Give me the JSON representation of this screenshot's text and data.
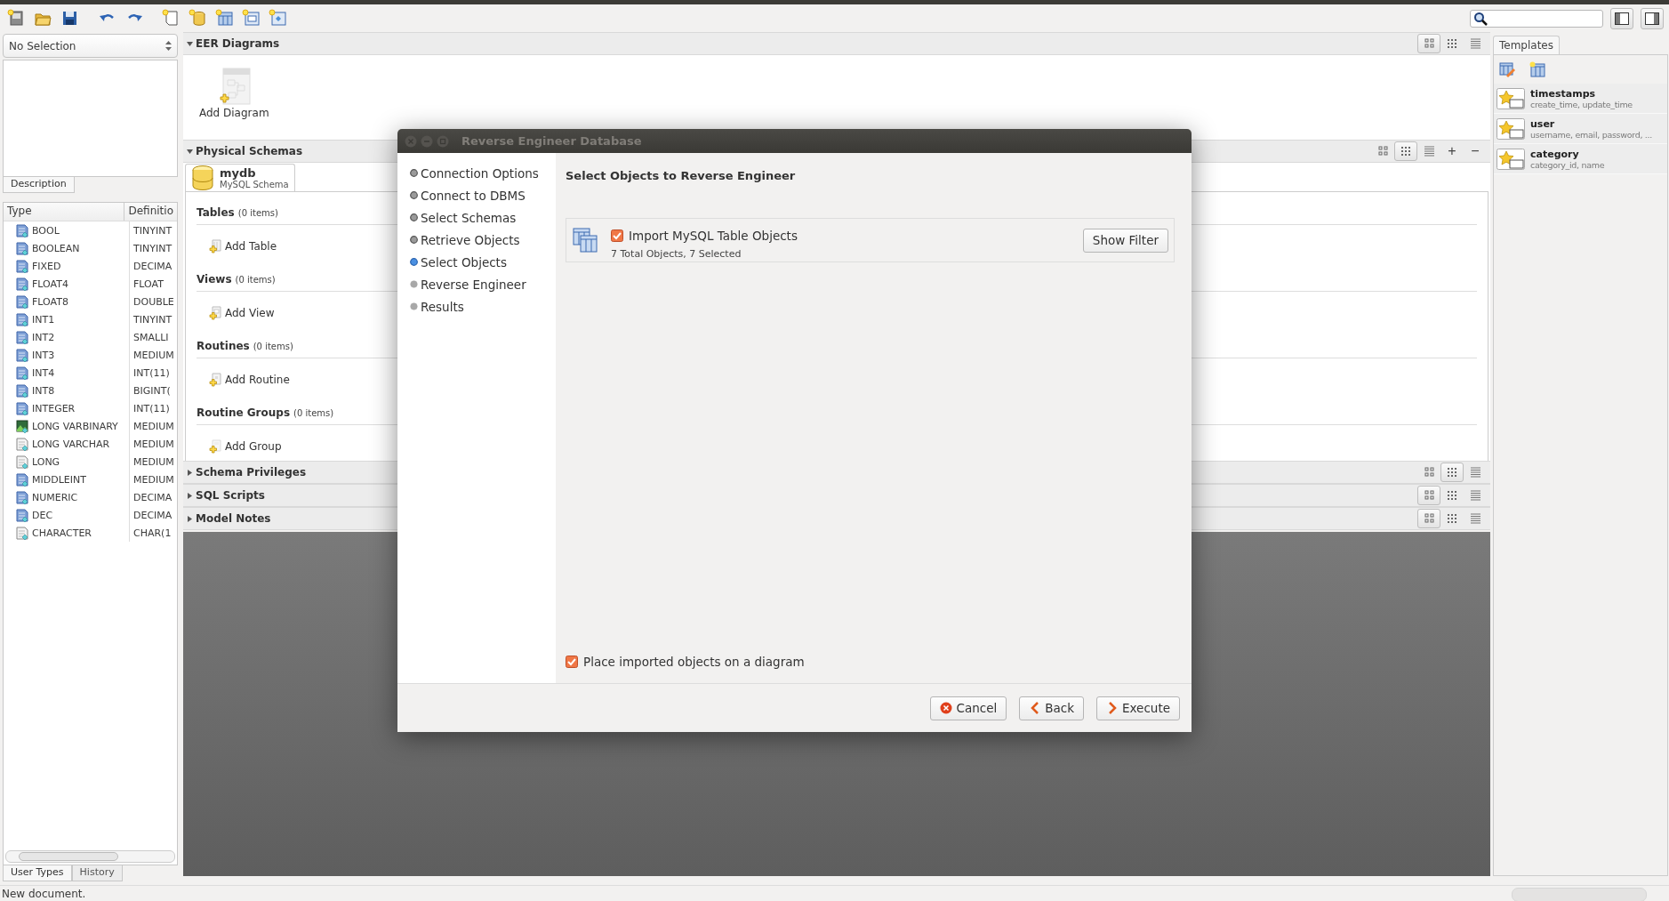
{
  "left_panel": {
    "selector": {
      "value": "No Selection"
    },
    "top_tabs": [
      {
        "label": "Description",
        "selected": true
      }
    ],
    "types_table": {
      "columns": [
        "Type",
        "Definitio"
      ],
      "rows": [
        {
          "kind": "numeric",
          "type": "BOOL",
          "definition": "TINYINT"
        },
        {
          "kind": "numeric",
          "type": "BOOLEAN",
          "definition": "TINYINT"
        },
        {
          "kind": "numeric",
          "type": "FIXED",
          "definition": "DECIMA"
        },
        {
          "kind": "numeric",
          "type": "FLOAT4",
          "definition": "FLOAT"
        },
        {
          "kind": "numeric",
          "type": "FLOAT8",
          "definition": "DOUBLE"
        },
        {
          "kind": "numeric",
          "type": "INT1",
          "definition": "TINYINT"
        },
        {
          "kind": "numeric",
          "type": "INT2",
          "definition": "SMALLI"
        },
        {
          "kind": "numeric",
          "type": "INT3",
          "definition": "MEDIUM"
        },
        {
          "kind": "numeric",
          "type": "INT4",
          "definition": "INT(11)"
        },
        {
          "kind": "numeric",
          "type": "INT8",
          "definition": "BIGINT("
        },
        {
          "kind": "numeric",
          "type": "INTEGER",
          "definition": "INT(11)"
        },
        {
          "kind": "blob",
          "type": "LONG VARBINARY",
          "definition": "MEDIUM"
        },
        {
          "kind": "text",
          "type": "LONG VARCHAR",
          "definition": "MEDIUM"
        },
        {
          "kind": "text",
          "type": "LONG",
          "definition": "MEDIUM"
        },
        {
          "kind": "numeric",
          "type": "MIDDLEINT",
          "definition": "MEDIUM"
        },
        {
          "kind": "numeric",
          "type": "NUMERIC",
          "definition": "DECIMA"
        },
        {
          "kind": "numeric",
          "type": "DEC",
          "definition": "DECIMA"
        },
        {
          "kind": "text",
          "type": "CHARACTER",
          "definition": "CHAR(1"
        }
      ]
    },
    "bottom_tabs": [
      {
        "label": "User Types",
        "selected": true
      },
      {
        "label": "History",
        "selected": false
      }
    ]
  },
  "sections": [
    {
      "kind": "diagrams",
      "title": "EER Diagrams",
      "expanded": true,
      "views": [
        {
          "kind": "large",
          "selected": true
        },
        {
          "kind": "small",
          "selected": false
        },
        {
          "kind": "list",
          "selected": false
        }
      ],
      "items": [
        {
          "label": "Add Diagram"
        }
      ]
    },
    {
      "kind": "schemas",
      "title": "Physical Schemas",
      "expanded": true,
      "views": [
        {
          "kind": "large",
          "selected": false
        },
        {
          "kind": "small",
          "selected": true
        },
        {
          "kind": "list",
          "selected": false
        }
      ],
      "actions": [
        "+",
        "−"
      ],
      "schema": {
        "name": "mydb",
        "type": "MySQL Schema",
        "selected": true
      },
      "groups": [
        {
          "kind": "table",
          "title": "Tables",
          "count": "(0 items)",
          "add_label": "Add Table"
        },
        {
          "kind": "view",
          "title": "Views",
          "count": "(0 items)",
          "add_label": "Add View"
        },
        {
          "kind": "routine",
          "title": "Routines",
          "count": "(0 items)",
          "add_label": "Add Routine"
        },
        {
          "kind": "group",
          "title": "Routine Groups",
          "count": "(0 items)",
          "add_label": "Add Group"
        }
      ]
    },
    {
      "title": "Schema Privileges",
      "expanded": false,
      "views": [
        {
          "kind": "large",
          "selected": false
        },
        {
          "kind": "small",
          "selected": true
        },
        {
          "kind": "list",
          "selected": false
        }
      ]
    },
    {
      "title": "SQL Scripts",
      "expanded": false,
      "views": [
        {
          "kind": "large",
          "selected": true
        },
        {
          "kind": "small",
          "selected": false
        },
        {
          "kind": "list",
          "selected": false
        }
      ]
    },
    {
      "title": "Model Notes",
      "expanded": false,
      "views": [
        {
          "kind": "large",
          "selected": true
        },
        {
          "kind": "small",
          "selected": false
        },
        {
          "kind": "list",
          "selected": false
        }
      ]
    }
  ],
  "templates": {
    "tab": "Templates",
    "items": [
      {
        "name": "timestamps",
        "detail": "create_time, update_time"
      },
      {
        "name": "user",
        "detail": "username, email, password, ..."
      },
      {
        "name": "category",
        "detail": "category_id, name"
      }
    ]
  },
  "dialog": {
    "title": "Reverse Engineer Database",
    "steps": [
      {
        "label": "Connection Options",
        "done": true,
        "selected": false
      },
      {
        "label": "Connect to DBMS",
        "done": true,
        "selected": false
      },
      {
        "label": "Select Schemas",
        "done": true,
        "selected": false
      },
      {
        "label": "Retrieve Objects",
        "done": true,
        "selected": false
      },
      {
        "label": "Select Objects",
        "done": false,
        "selected": true
      },
      {
        "label": "Reverse Engineer",
        "done": false,
        "selected": false
      },
      {
        "label": "Results",
        "done": false,
        "selected": false
      }
    ],
    "heading": "Select Objects to Reverse Engineer",
    "import": {
      "label": "Import MySQL Table Objects",
      "checked": true,
      "summary": "7 Total Objects, 7 Selected",
      "filter_button": "Show Filter"
    },
    "place_on_diagram": {
      "label": "Place imported objects on a diagram",
      "checked": true
    },
    "buttons": [
      {
        "kind": "cancel",
        "label": "Cancel"
      },
      {
        "kind": "back",
        "label": "Back"
      },
      {
        "kind": "next",
        "label": "Execute"
      }
    ]
  },
  "status_bar": {
    "text": "New document."
  }
}
